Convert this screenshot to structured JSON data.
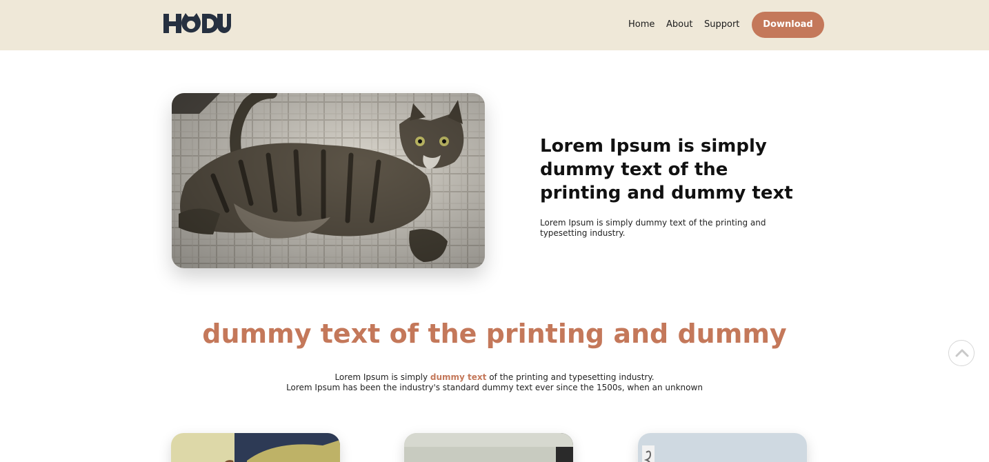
{
  "header": {
    "logo_text": "HODU",
    "nav": {
      "home": "Home",
      "about": "About",
      "support": "Support"
    },
    "download_label": "Download"
  },
  "hero": {
    "title": "Lorem Ipsum is simply dummy text of the printing and dummy text",
    "text": "Lorem Ipsum is simply dummy text of the printing and typesetting industry."
  },
  "section": {
    "title": "dummy text of the printing and dummy",
    "line1_before": "Lorem Ipsum is simply ",
    "line1_highlight": "dummy text",
    "line1_after": " of the printing and typesetting industry.",
    "line2": "Lorem Ipsum has been the industry's standard dummy text ever since the 1500s, when an unknown"
  },
  "colors": {
    "accent": "#c4785a",
    "header_bg": "#efe8d8",
    "logo": "#263040"
  },
  "icons": {
    "scroll_top": "chevron-up-icon"
  }
}
